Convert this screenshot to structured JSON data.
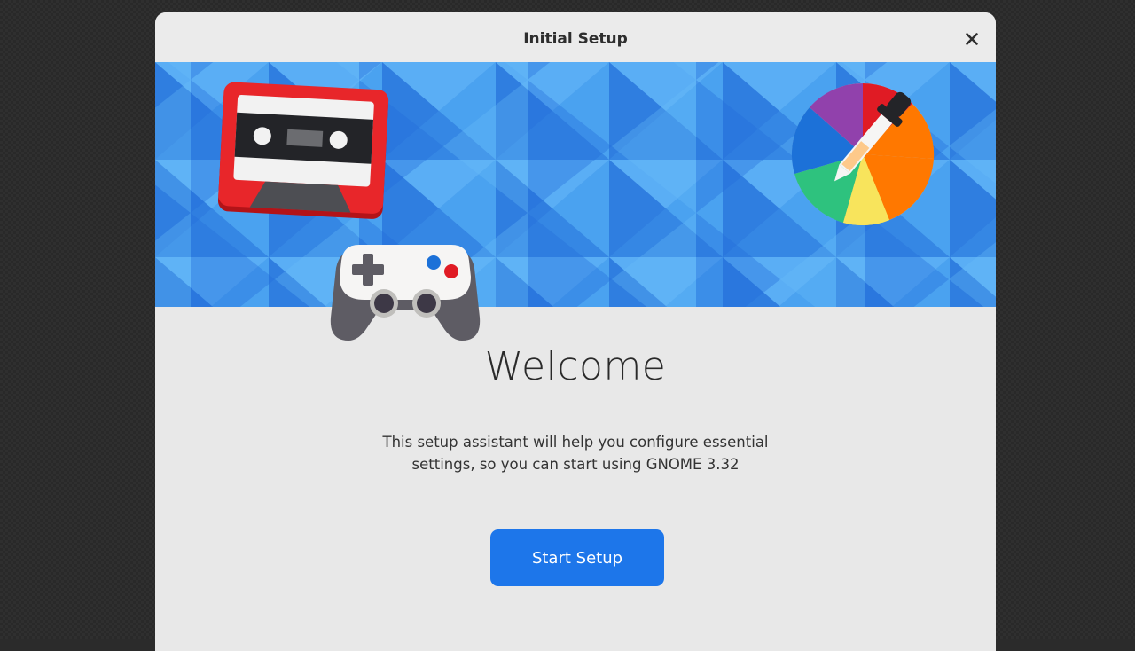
{
  "window": {
    "title": "Initial Setup",
    "close_icon": "close-icon"
  },
  "banner": {
    "illustrations": [
      "cassette-icon",
      "gamepad-icon",
      "color-wheel-icon",
      "eyedropper-icon"
    ]
  },
  "main": {
    "heading": "Welcome",
    "description_line1": "This setup assistant will help you configure essential",
    "description_line2": "settings, so you can start using GNOME 3.32",
    "start_button_label": "Start Setup"
  },
  "colors": {
    "accent": "#1d76ea",
    "window_bg": "#e8e8e8",
    "banner_blue": "#3b8eea"
  }
}
